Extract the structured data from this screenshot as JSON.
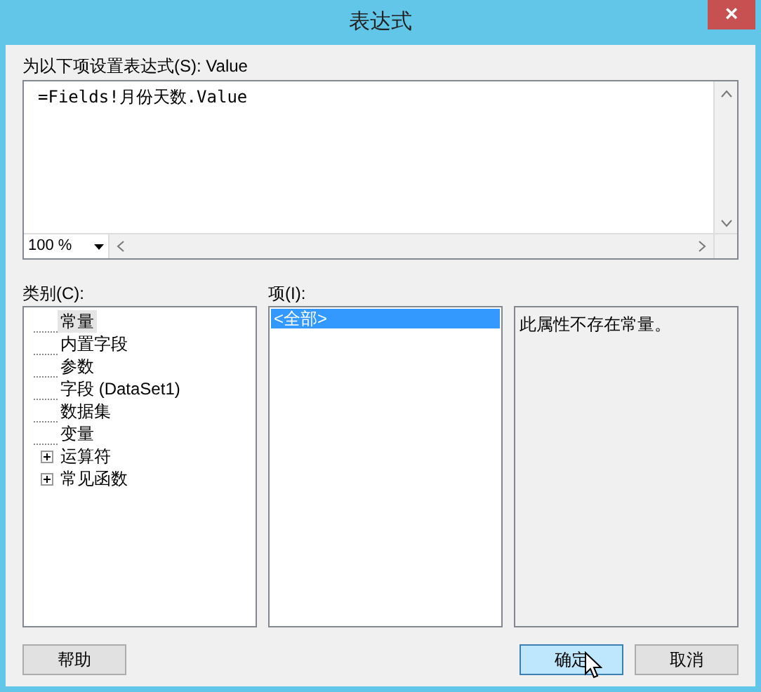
{
  "window": {
    "title": "表达式",
    "close": "×"
  },
  "expression": {
    "label": "为以下项设置表达式(S): Value",
    "value": "=Fields!月份天数.Value",
    "zoom": "100 %"
  },
  "category": {
    "label": "类别(C):",
    "items": [
      {
        "label": "常量",
        "selected": true
      },
      {
        "label": "内置字段",
        "selected": false
      },
      {
        "label": "参数",
        "selected": false
      },
      {
        "label": "字段 (DataSet1)",
        "selected": false
      },
      {
        "label": "数据集",
        "selected": false
      },
      {
        "label": "变量",
        "selected": false
      },
      {
        "label": "运算符",
        "selected": false,
        "expanded": false
      },
      {
        "label": "常见函数",
        "selected": false,
        "expanded": false
      }
    ]
  },
  "items": {
    "label": "项(I):",
    "items": [
      {
        "label": "<全部>",
        "selected": true
      }
    ]
  },
  "description": "此属性不存在常量。",
  "buttons": [
    {
      "label": "帮助",
      "hovered": false
    },
    {
      "label": "确定",
      "hovered": true
    },
    {
      "label": "取消",
      "hovered": false
    }
  ]
}
